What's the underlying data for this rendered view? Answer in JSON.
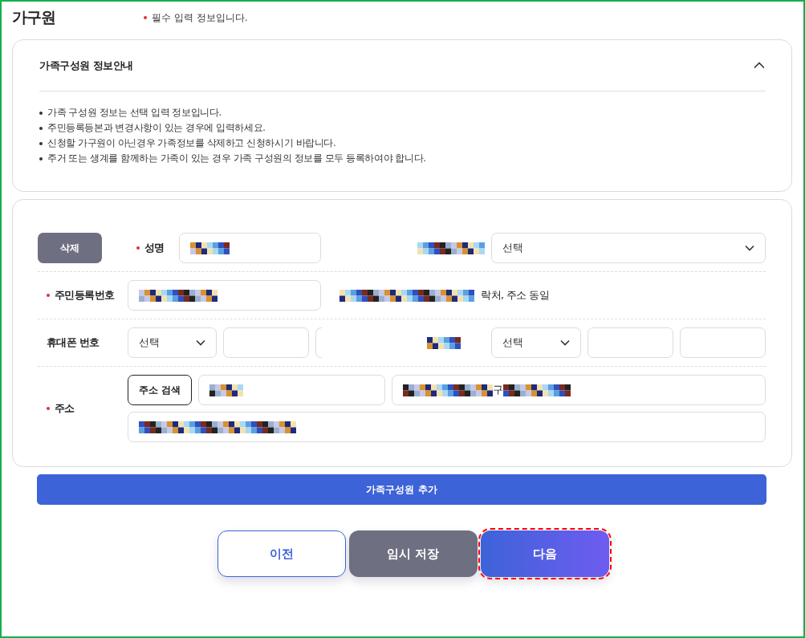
{
  "title": "가구원",
  "required_note": {
    "text": "필수 입력 정보입니다.",
    "required": true
  },
  "info_panel": {
    "title": "가족구성원 정보안내",
    "expanded": true,
    "bullets": [
      "가족 구성원 정보는 선택 입력 정보입니다.",
      "주민등록등본과 변경사항이 있는 경우에 입력하세요.",
      "신청할 가구원이 아닌경우 가족정보를 삭제하고 신청하시기 바랍니다.",
      "주거 또는 생계를 함께하는 가족이 있는 경우 가족 구성원의 정보를 모두 등록하여야 합니다."
    ]
  },
  "member_form": {
    "delete_button": "삭제",
    "name": {
      "label": "성명",
      "required": true
    },
    "relation_select": {
      "placeholder": "선택"
    },
    "resident_number": {
      "label": "주민등록번호",
      "required": true
    },
    "same_contact_option": {
      "label": "락처, 주소 동일"
    },
    "mobile_phone": {
      "label": "휴대폰 번호",
      "required": false,
      "prefix_select": "선택"
    },
    "second_phone": {
      "prefix_select": "선택"
    },
    "address": {
      "label": "주소",
      "required": true,
      "search_button": "주소 검색",
      "road_address_fragment": "구"
    }
  },
  "add_member_button": "가족구성원 추가",
  "nav_buttons": [
    {
      "label": "이전",
      "kind": "outline",
      "focused": false
    },
    {
      "label": "임시 저장",
      "kind": "gray",
      "focused": false
    },
    {
      "label": "다음",
      "kind": "primary",
      "focused": true
    }
  ]
}
